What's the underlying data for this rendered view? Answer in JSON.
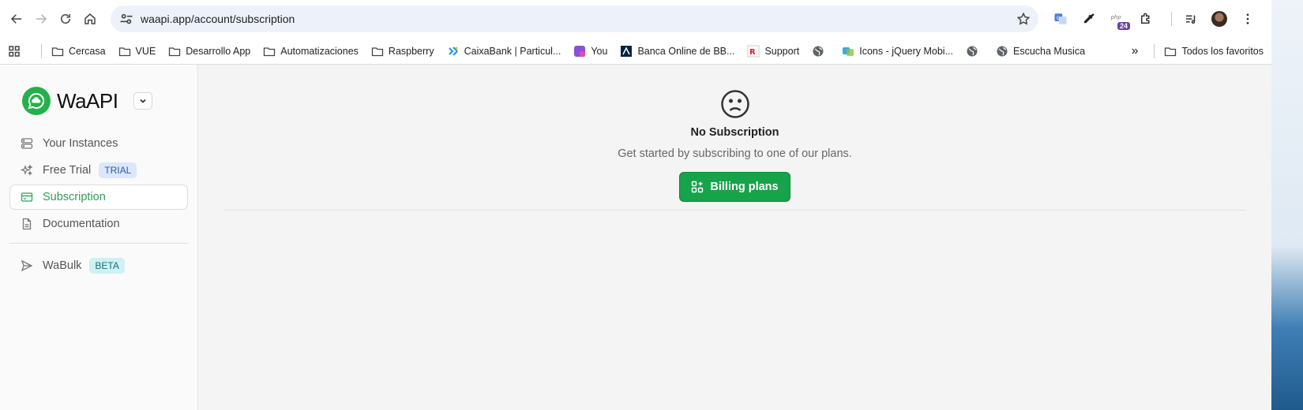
{
  "browser": {
    "url": "waapi.app/account/subscription",
    "extension_badge": "24"
  },
  "bookmarks": {
    "items": [
      {
        "label": "Cercasa",
        "icon": "folder-icon"
      },
      {
        "label": "VUE",
        "icon": "folder-icon"
      },
      {
        "label": "Desarrollo App",
        "icon": "folder-icon"
      },
      {
        "label": "Automatizaciones",
        "icon": "folder-icon"
      },
      {
        "label": "Raspberry",
        "icon": "folder-icon"
      },
      {
        "label": "CaixaBank | Particul...",
        "icon": "caixabank-icon"
      },
      {
        "label": "You",
        "icon": "you-icon"
      },
      {
        "label": "Banca Online de BB...",
        "icon": "bbva-icon"
      },
      {
        "label": "Support",
        "icon": "support-icon"
      },
      {
        "label": "",
        "icon": "globe-icon"
      },
      {
        "label": "Icons - jQuery Mobi...",
        "icon": "jquery-icon"
      },
      {
        "label": "",
        "icon": "globe-icon"
      },
      {
        "label": "Escucha Musica",
        "icon": "globe-icon"
      }
    ],
    "overflow": "»",
    "all_bookmarks": "Todos los favoritos"
  },
  "sidebar": {
    "brand": "WaAPI",
    "items": [
      {
        "label": "Your Instances",
        "icon": "server-icon"
      },
      {
        "label": "Free Trial",
        "icon": "sparkles-icon",
        "badge": "TRIAL"
      },
      {
        "label": "Subscription",
        "icon": "credit-card-icon",
        "active": true
      },
      {
        "label": "Documentation",
        "icon": "document-icon"
      }
    ],
    "secondary_items": [
      {
        "label": "WaBulk",
        "icon": "send-icon",
        "badge": "BETA"
      }
    ]
  },
  "main": {
    "empty_state": {
      "icon": "sad-face-icon",
      "title": "No Subscription",
      "subtitle": "Get started by subscribing to one of our plans.",
      "button_label": "Billing plans",
      "button_icon": "squares-plus-icon"
    }
  },
  "colors": {
    "accent": "#16a34a",
    "active_nav": "#2f9d56",
    "trial_badge_bg": "#dbe7fa",
    "beta_badge_bg": "#cdf1f5",
    "brand_logo": "#22b14c"
  }
}
